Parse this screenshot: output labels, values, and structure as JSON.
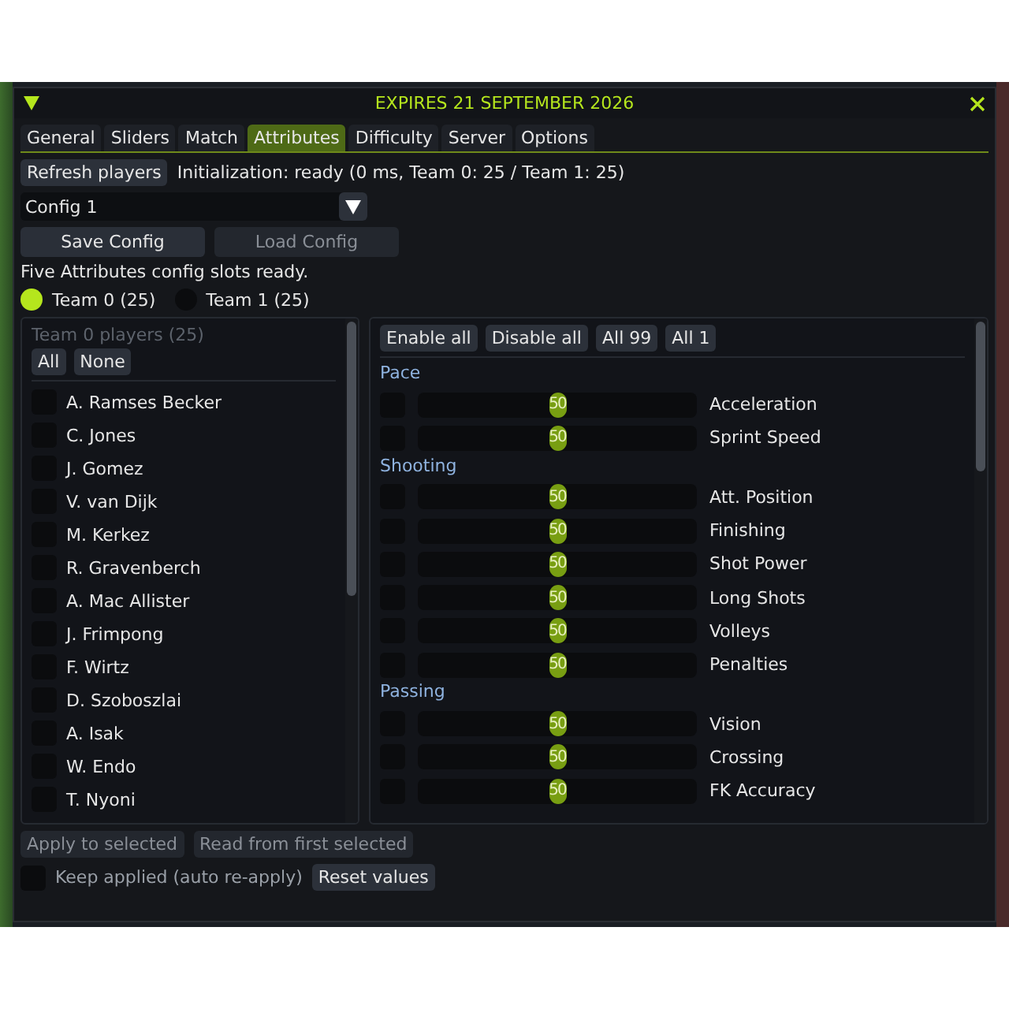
{
  "window": {
    "title": "EXPIRES 21 SEPTEMBER 2026"
  },
  "tabs": [
    {
      "label": "General",
      "selected": false
    },
    {
      "label": "Sliders",
      "selected": false
    },
    {
      "label": "Match",
      "selected": false
    },
    {
      "label": "Attributes",
      "selected": true
    },
    {
      "label": "Difficulty",
      "selected": false
    },
    {
      "label": "Server",
      "selected": false
    },
    {
      "label": "Options",
      "selected": false
    }
  ],
  "refresh_button": "Refresh players",
  "init_status": "Initialization: ready (0 ms, Team 0: 25 / Team 1: 25)",
  "config_select": {
    "value": "Config 1"
  },
  "config_buttons": [
    {
      "label": "Save Config",
      "disabled": false
    },
    {
      "label": "Load Config",
      "disabled": true
    }
  ],
  "config_message": "Five Attributes config slots ready.",
  "teams": [
    {
      "label": "Team 0 (25)",
      "selected": true
    },
    {
      "label": "Team 1 (25)",
      "selected": false
    }
  ],
  "players_panel": {
    "heading": "Team 0 players (25)",
    "buttons": [
      "All",
      "None"
    ],
    "players": [
      {
        "name": "A. Ramses Becker",
        "checked": false
      },
      {
        "name": "C. Jones",
        "checked": false
      },
      {
        "name": "J. Gomez",
        "checked": false
      },
      {
        "name": "V. van Dijk",
        "checked": false
      },
      {
        "name": "M. Kerkez",
        "checked": false
      },
      {
        "name": "R. Gravenberch",
        "checked": false
      },
      {
        "name": "A. Mac Allister",
        "checked": false
      },
      {
        "name": "J. Frimpong",
        "checked": false
      },
      {
        "name": "F. Wirtz",
        "checked": false
      },
      {
        "name": "D. Szoboszlai",
        "checked": false
      },
      {
        "name": "A. Isak",
        "checked": false
      },
      {
        "name": "W. Endo",
        "checked": false
      },
      {
        "name": "T. Nyoni",
        "checked": false
      }
    ]
  },
  "attributes_panel": {
    "buttons": [
      "Enable all",
      "Disable all",
      "All 99",
      "All 1"
    ],
    "groups": [
      {
        "name": "Pace",
        "attributes": [
          {
            "name": "Acceleration",
            "enabled": false,
            "level": 0.5,
            "reading": "50"
          },
          {
            "name": "Sprint Speed",
            "enabled": false,
            "level": 0.5,
            "reading": "50"
          }
        ]
      },
      {
        "name": "Shooting",
        "attributes": [
          {
            "name": "Att. Position",
            "enabled": false,
            "level": 0.5,
            "reading": "50"
          },
          {
            "name": "Finishing",
            "enabled": false,
            "level": 0.5,
            "reading": "50"
          },
          {
            "name": "Shot Power",
            "enabled": false,
            "level": 0.5,
            "reading": "50"
          },
          {
            "name": "Long Shots",
            "enabled": false,
            "level": 0.5,
            "reading": "50"
          },
          {
            "name": "Volleys",
            "enabled": false,
            "level": 0.5,
            "reading": "50"
          },
          {
            "name": "Penalties",
            "enabled": false,
            "level": 0.5,
            "reading": "50"
          }
        ]
      },
      {
        "name": "Passing",
        "attributes": [
          {
            "name": "Vision",
            "enabled": false,
            "level": 0.5,
            "reading": "50"
          },
          {
            "name": "Crossing",
            "enabled": false,
            "level": 0.5,
            "reading": "50"
          },
          {
            "name": "FK Accuracy",
            "enabled": false,
            "level": 0.5,
            "reading": "50"
          }
        ]
      }
    ]
  },
  "action_buttons": [
    {
      "label": "Apply to selected",
      "disabled": true
    },
    {
      "label": "Read from first selected",
      "disabled": true
    }
  ],
  "keep_applied": {
    "label": "Keep applied (auto re-apply)",
    "checked": false
  },
  "reset_button": "Reset values"
}
